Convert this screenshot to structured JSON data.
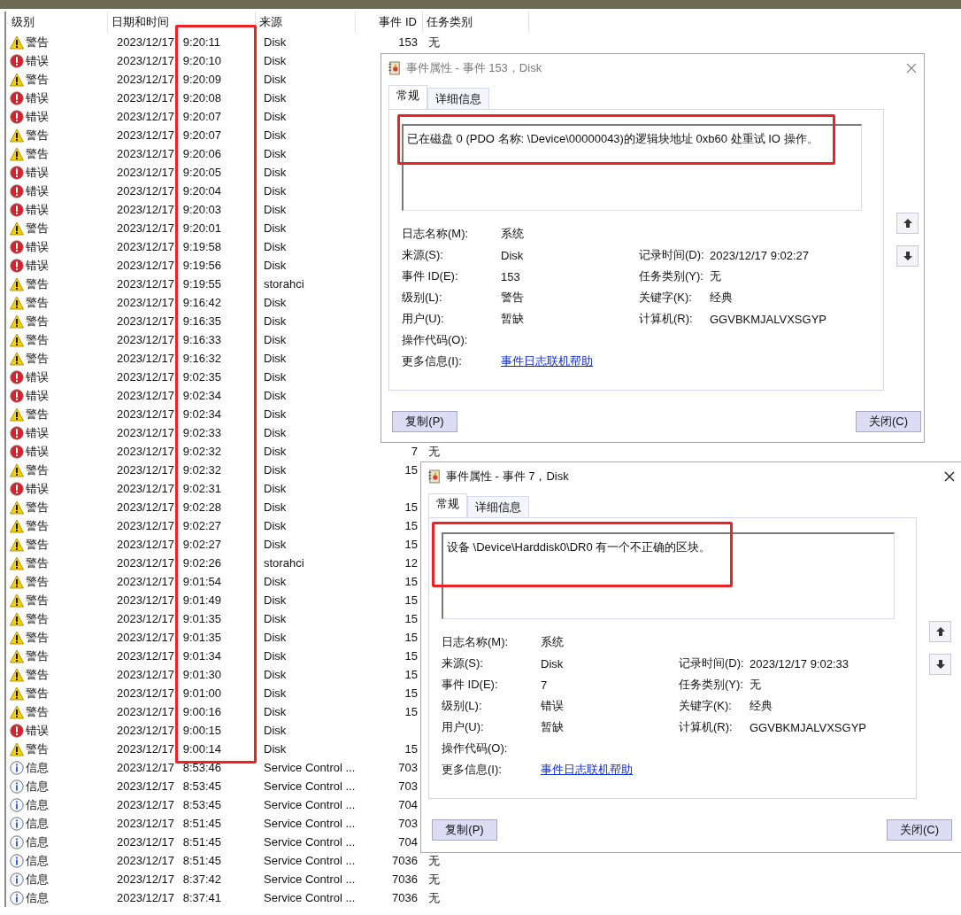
{
  "event_list": {
    "columns": [
      "级别",
      "日期和时间",
      "来源",
      "事件 ID",
      "任务类别"
    ],
    "rows": [
      {
        "kind": "warning",
        "level": "警告",
        "time": "2023/12/17 9:20:11",
        "source": "Disk",
        "event_id": "153",
        "task": "无"
      },
      {
        "kind": "error",
        "level": "错误",
        "time": "2023/12/17 9:20:10",
        "source": "Disk"
      },
      {
        "kind": "warning",
        "level": "警告",
        "time": "2023/12/17 9:20:09",
        "source": "Disk"
      },
      {
        "kind": "error",
        "level": "错误",
        "time": "2023/12/17 9:20:08",
        "source": "Disk"
      },
      {
        "kind": "error",
        "level": "错误",
        "time": "2023/12/17 9:20:07",
        "source": "Disk"
      },
      {
        "kind": "warning",
        "level": "警告",
        "time": "2023/12/17 9:20:07",
        "source": "Disk"
      },
      {
        "kind": "warning",
        "level": "警告",
        "time": "2023/12/17 9:20:06",
        "source": "Disk"
      },
      {
        "kind": "error",
        "level": "错误",
        "time": "2023/12/17 9:20:05",
        "source": "Disk"
      },
      {
        "kind": "error",
        "level": "错误",
        "time": "2023/12/17 9:20:04",
        "source": "Disk"
      },
      {
        "kind": "error",
        "level": "错误",
        "time": "2023/12/17 9:20:03",
        "source": "Disk"
      },
      {
        "kind": "warning",
        "level": "警告",
        "time": "2023/12/17 9:20:01",
        "source": "Disk"
      },
      {
        "kind": "error",
        "level": "错误",
        "time": "2023/12/17 9:19:58",
        "source": "Disk"
      },
      {
        "kind": "error",
        "level": "错误",
        "time": "2023/12/17 9:19:56",
        "source": "Disk"
      },
      {
        "kind": "warning",
        "level": "警告",
        "time": "2023/12/17 9:19:55",
        "source": "storahci"
      },
      {
        "kind": "warning",
        "level": "警告",
        "time": "2023/12/17 9:16:42",
        "source": "Disk"
      },
      {
        "kind": "warning",
        "level": "警告",
        "time": "2023/12/17 9:16:35",
        "source": "Disk"
      },
      {
        "kind": "warning",
        "level": "警告",
        "time": "2023/12/17 9:16:33",
        "source": "Disk"
      },
      {
        "kind": "warning",
        "level": "警告",
        "time": "2023/12/17 9:16:32",
        "source": "Disk"
      },
      {
        "kind": "error",
        "level": "错误",
        "time": "2023/12/17 9:02:35",
        "source": "Disk"
      },
      {
        "kind": "error",
        "level": "错误",
        "time": "2023/12/17 9:02:34",
        "source": "Disk"
      },
      {
        "kind": "warning",
        "level": "警告",
        "time": "2023/12/17 9:02:34",
        "source": "Disk"
      },
      {
        "kind": "error",
        "level": "错误",
        "time": "2023/12/17 9:02:33",
        "source": "Disk"
      },
      {
        "kind": "error",
        "level": "错误",
        "time": "2023/12/17 9:02:32",
        "source": "Disk",
        "event_id": "7",
        "task": "无"
      },
      {
        "kind": "warning",
        "level": "警告",
        "time": "2023/12/17 9:02:32",
        "source": "Disk",
        "event_id": "15"
      },
      {
        "kind": "error",
        "level": "错误",
        "time": "2023/12/17 9:02:31",
        "source": "Disk"
      },
      {
        "kind": "warning",
        "level": "警告",
        "time": "2023/12/17 9:02:28",
        "source": "Disk",
        "event_id": "15"
      },
      {
        "kind": "warning",
        "level": "警告",
        "time": "2023/12/17 9:02:27",
        "source": "Disk",
        "event_id": "15"
      },
      {
        "kind": "warning",
        "level": "警告",
        "time": "2023/12/17 9:02:27",
        "source": "Disk",
        "event_id": "15"
      },
      {
        "kind": "warning",
        "level": "警告",
        "time": "2023/12/17 9:02:26",
        "source": "storahci",
        "event_id": "12"
      },
      {
        "kind": "warning",
        "level": "警告",
        "time": "2023/12/17 9:01:54",
        "source": "Disk",
        "event_id": "15"
      },
      {
        "kind": "warning",
        "level": "警告",
        "time": "2023/12/17 9:01:49",
        "source": "Disk",
        "event_id": "15"
      },
      {
        "kind": "warning",
        "level": "警告",
        "time": "2023/12/17 9:01:35",
        "source": "Disk",
        "event_id": "15"
      },
      {
        "kind": "warning",
        "level": "警告",
        "time": "2023/12/17 9:01:35",
        "source": "Disk",
        "event_id": "15"
      },
      {
        "kind": "warning",
        "level": "警告",
        "time": "2023/12/17 9:01:34",
        "source": "Disk",
        "event_id": "15"
      },
      {
        "kind": "warning",
        "level": "警告",
        "time": "2023/12/17 9:01:30",
        "source": "Disk",
        "event_id": "15"
      },
      {
        "kind": "warning",
        "level": "警告",
        "time": "2023/12/17 9:01:00",
        "source": "Disk",
        "event_id": "15"
      },
      {
        "kind": "warning",
        "level": "警告",
        "time": "2023/12/17 9:00:16",
        "source": "Disk",
        "event_id": "15"
      },
      {
        "kind": "error",
        "level": "错误",
        "time": "2023/12/17 9:00:15",
        "source": "Disk"
      },
      {
        "kind": "warning",
        "level": "警告",
        "time": "2023/12/17 9:00:14",
        "source": "Disk",
        "event_id": "15"
      },
      {
        "kind": "info",
        "level": "信息",
        "time": "2023/12/17 8:53:46",
        "source": "Service Control ...",
        "event_id": "703"
      },
      {
        "kind": "info",
        "level": "信息",
        "time": "2023/12/17 8:53:45",
        "source": "Service Control ...",
        "event_id": "703"
      },
      {
        "kind": "info",
        "level": "信息",
        "time": "2023/12/17 8:53:45",
        "source": "Service Control ...",
        "event_id": "704"
      },
      {
        "kind": "info",
        "level": "信息",
        "time": "2023/12/17 8:51:45",
        "source": "Service Control ...",
        "event_id": "703"
      },
      {
        "kind": "info",
        "level": "信息",
        "time": "2023/12/17 8:51:45",
        "source": "Service Control ...",
        "event_id": "704"
      },
      {
        "kind": "info",
        "level": "信息",
        "time": "2023/12/17 8:51:45",
        "source": "Service Control ...",
        "event_id": "7036",
        "task": "无"
      },
      {
        "kind": "info",
        "level": "信息",
        "time": "2023/12/17 8:37:42",
        "source": "Service Control ...",
        "event_id": "7036",
        "task": "无"
      },
      {
        "kind": "info",
        "level": "信息",
        "time": "2023/12/17 8:37:41",
        "source": "Service Control ...",
        "event_id": "7036",
        "task": "无"
      }
    ]
  },
  "dialogs": [
    {
      "title": "事件属性 - 事件 153，Disk",
      "active": false,
      "tabs": [
        {
          "label": "常规",
          "selected": true
        },
        {
          "label": "详细信息",
          "selected": false
        }
      ],
      "message": "已在磁盘 0 (PDO 名称: \\Device\\00000043)的逻辑块地址 0xb60 处重试 IO 操作。",
      "fields": [
        {
          "label": "日志名称(M):",
          "value": "系统"
        },
        {
          "label": "来源(S):",
          "value": "Disk",
          "right_label": "记录时间(D):",
          "right_value": "2023/12/17 9:02:27"
        },
        {
          "label": "事件 ID(E):",
          "value": "153",
          "right_label": "任务类别(Y):",
          "right_value": "无"
        },
        {
          "label": "级别(L):",
          "value": "警告",
          "right_label": "关键字(K):",
          "right_value": "经典"
        },
        {
          "label": "用户(U):",
          "value": "暂缺",
          "right_label": "计算机(R):",
          "right_value": "GGVBKMJALVXSGYP"
        },
        {
          "label": "操作代码(O):"
        },
        {
          "label": "更多信息(I):",
          "link": "事件日志联机帮助"
        }
      ],
      "buttons": [
        "复制(P)",
        "关闭(C)"
      ]
    },
    {
      "title": "事件属性 - 事件 7，Disk",
      "active": true,
      "tabs": [
        {
          "label": "常规",
          "selected": true
        },
        {
          "label": "详细信息",
          "selected": false
        }
      ],
      "message": "设备 \\Device\\Harddisk0\\DR0 有一个不正确的区块。",
      "fields": [
        {
          "label": "日志名称(M):",
          "value": "系统"
        },
        {
          "label": "来源(S):",
          "value": "Disk",
          "right_label": "记录时间(D):",
          "right_value": "2023/12/17 9:02:33"
        },
        {
          "label": "事件 ID(E):",
          "value": "7",
          "right_label": "任务类别(Y):",
          "right_value": "无"
        },
        {
          "label": "级别(L):",
          "value": "错误",
          "right_label": "关键字(K):",
          "right_value": "经典"
        },
        {
          "label": "用户(U):",
          "value": "暂缺",
          "right_label": "计算机(R):",
          "right_value": "GGVBKMJALVXSGYP"
        },
        {
          "label": "操作代码(O):"
        },
        {
          "label": "更多信息(I):",
          "link": "事件日志联机帮助"
        }
      ],
      "buttons": [
        "复制(P)",
        "关闭(C)"
      ]
    }
  ]
}
